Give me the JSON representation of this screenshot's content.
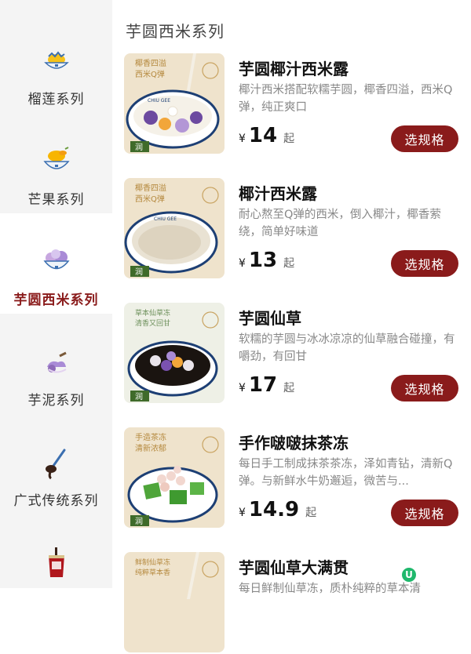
{
  "sidebar": {
    "categories": [
      {
        "label": "榴莲系列",
        "icon": "durian-bowl-icon",
        "active": false
      },
      {
        "label": "芒果系列",
        "icon": "mango-bowl-icon",
        "active": false
      },
      {
        "label": "芋圆西米系列",
        "icon": "taro-ball-bowl-icon",
        "active": true
      },
      {
        "label": "芋泥系列",
        "icon": "taro-paste-icon",
        "active": false
      },
      {
        "label": "广式传统系列",
        "icon": "spoon-sauce-icon",
        "active": false
      },
      {
        "label": "",
        "icon": "drink-cup-icon",
        "active": false
      }
    ]
  },
  "section": {
    "title": "芋圆西米系列"
  },
  "products": [
    {
      "name": "芋圆椰汁西米露",
      "desc": "椰汁西米搭配软糯芋圆，椰香四溢，西米Q弹，纯正爽口",
      "currency": "¥",
      "price": "14",
      "suffix": "起",
      "button": "选规格",
      "image_text": {
        "tagline1": "椰香四溢",
        "tagline2": "西米Q弹",
        "brand": "CHIU GEE",
        "badge": "润"
      }
    },
    {
      "name": "椰汁西米露",
      "desc": "耐心熬至Q弹的西米，倒入椰汁，椰香萦绕，简单好味道",
      "currency": "¥",
      "price": "13",
      "suffix": "起",
      "button": "选规格",
      "image_text": {
        "tagline1": "椰香四溢",
        "tagline2": "西米Q弹",
        "brand": "CHIU GEE",
        "badge": "润"
      }
    },
    {
      "name": "芋圆仙草",
      "desc": "软糯的芋圆与冰冰凉凉的仙草融合碰撞，有嚼劲，有回甘",
      "currency": "¥",
      "price": "17",
      "suffix": "起",
      "button": "选规格",
      "image_text": {
        "tagline1": "草本仙草冻",
        "tagline2": "清香又回甘",
        "brand": "",
        "badge": "润"
      }
    },
    {
      "name": "手作啵啵抹茶冻",
      "desc": "每日手工制成抹茶茶冻，泽如青钻，清新Q弹。与新鲜水牛奶邂逅，微苦与...",
      "currency": "¥",
      "price": "14.9",
      "suffix": "起",
      "button": "选规格",
      "image_text": {
        "tagline1": "手造茶冻",
        "tagline2": "清新浓郁",
        "brand": "",
        "badge": "润"
      }
    },
    {
      "name": "芋圆仙草大满贯",
      "desc": "每日鲜制仙草冻，质朴纯粹的草本清",
      "currency": "¥",
      "price": "",
      "suffix": "",
      "button": "",
      "image_text": {
        "tagline1": "鲜制仙草冻",
        "tagline2": "纯粹草本香",
        "brand": "",
        "badge": ""
      }
    }
  ],
  "floating_badge": {
    "text": "U",
    "color": "#1fb86c"
  },
  "colors": {
    "accent": "#8a1b1b",
    "sidebar_bg": "#f4f4f4",
    "thumb_bg": "#efe3cc"
  }
}
